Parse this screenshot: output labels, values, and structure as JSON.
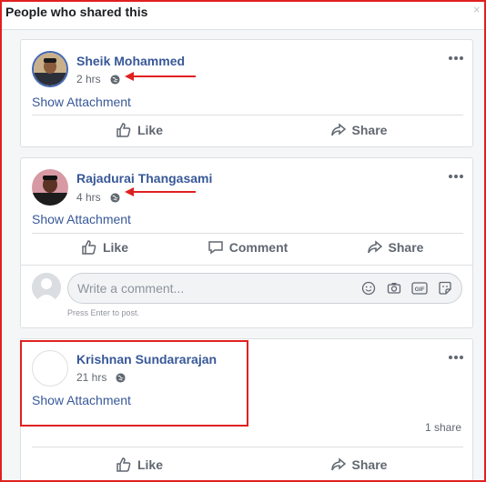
{
  "dialog": {
    "title": "People who shared this",
    "close_glyph": "×"
  },
  "posts": [
    {
      "author": "Sheik Mohammed",
      "time": "2 hrs",
      "privacy_icon": "globe-icon",
      "attachment_link": "Show Attachment",
      "actions": [
        "Like",
        "Share"
      ]
    },
    {
      "author": "Rajadurai Thangasami",
      "time": "4 hrs",
      "privacy_icon": "globe-icon",
      "attachment_link": "Show Attachment",
      "actions": [
        "Like",
        "Comment",
        "Share"
      ],
      "comment": {
        "placeholder": "Write a comment...",
        "hint": "Press Enter to post.",
        "tools": [
          "emoji-icon",
          "camera-icon",
          "gif-icon",
          "sticker-icon"
        ]
      }
    },
    {
      "author": "Krishnan Sundararajan",
      "time": "21 hrs",
      "privacy_icon": "globe-icon",
      "attachment_link": "Show Attachment",
      "share_count": "1 share",
      "actions": [
        "Like",
        "Share"
      ]
    }
  ],
  "colors": {
    "link_blue": "#385898",
    "annotation_red": "#e02020",
    "action_gray": "#606770"
  }
}
